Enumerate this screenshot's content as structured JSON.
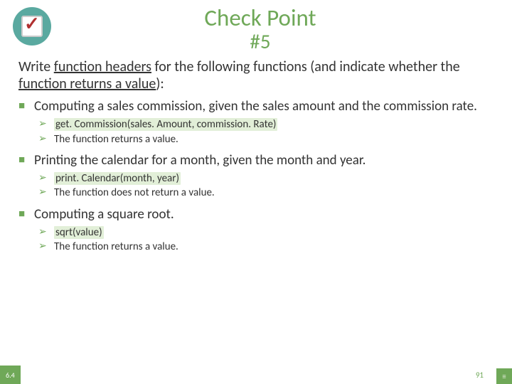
{
  "title": {
    "line1": "Check Point",
    "line2": "#5"
  },
  "prompt": {
    "pre": "Write ",
    "u1": "function headers",
    "mid": " for the following functions (and indicate whether the ",
    "u2": "function returns a value",
    "post": "):"
  },
  "items": [
    {
      "justify": true,
      "text": "Computing a sales commission, given the sales amount and the commission rate.",
      "answers": [
        {
          "hl": true,
          "text": "get. Commission(sales. Amount, commission. Rate)"
        },
        {
          "hl": false,
          "text": "The function returns a value."
        }
      ]
    },
    {
      "justify": false,
      "text": "Printing the calendar for a month, given the month and year.",
      "answers": [
        {
          "hl": true,
          "text": " print. Calendar(month, year)"
        },
        {
          "hl": false,
          "text": "The function does not return a value."
        }
      ]
    },
    {
      "justify": false,
      "text": "Computing a square root.",
      "answers": [
        {
          "hl": true,
          "text": "sqrt(value)"
        },
        {
          "hl": false,
          "text": "The function returns a value."
        }
      ]
    }
  ],
  "footer": {
    "section": "6.4",
    "page": "91",
    "corner": "≡"
  }
}
